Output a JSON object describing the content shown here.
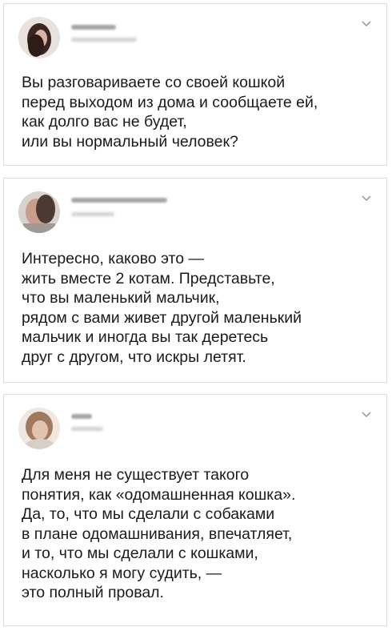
{
  "tweets": [
    {
      "lines": [
        "Вы разговариваете со своей кошкой",
        "перед выходом из дома и сообщаете ей,",
        "как долго вас не будет,",
        "или вы нормальный человек?"
      ]
    },
    {
      "lines": [
        "Интересно, каково это —",
        "жить вместе 2 котам. Представьте,",
        "что вы маленький мальчик,",
        "рядом с вами живет другой маленький",
        "мальчик и иногда вы так деретесь",
        "друг с другом, что искры летят."
      ]
    },
    {
      "lines": [
        "Для меня не существует такого",
        "понятия, как «одомашненная кошка».",
        "Да, то, что мы сделали с собаками",
        "в плане одомашнивания, впечатляет,",
        "и то, что мы сделали с кошками,",
        "насколько я могу судить, —",
        "это полный провал."
      ]
    }
  ],
  "icons": {
    "avatar": "avatar-photo",
    "menu": "chevron-down-icon"
  },
  "colors": {
    "text": "#1a1a1a",
    "border": "#dcdcdc",
    "chevron": "#8899a6"
  }
}
